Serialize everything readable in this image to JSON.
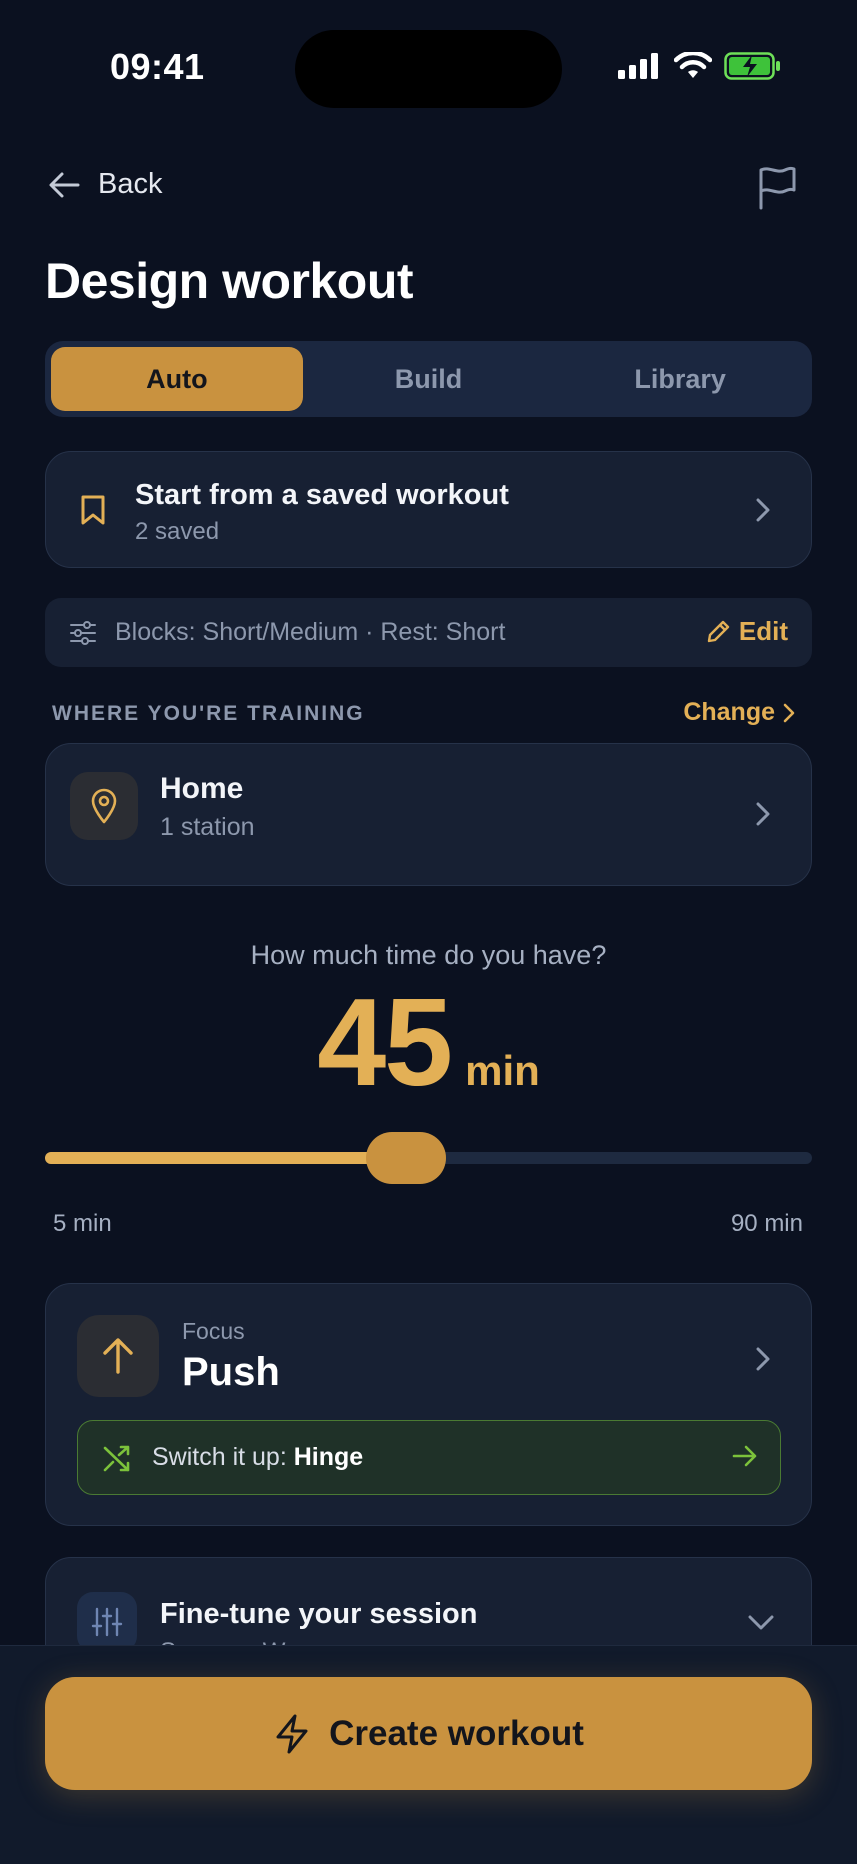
{
  "status_bar": {
    "time": "09:41"
  },
  "nav": {
    "back_label": "Back"
  },
  "page": {
    "title": "Design workout"
  },
  "segmented": {
    "tabs": [
      "Auto",
      "Build",
      "Library"
    ],
    "active": "Auto"
  },
  "saved": {
    "title": "Start from a saved workout",
    "subtitle": "2 saved"
  },
  "summary": {
    "text": "Blocks: Short/Medium · Rest: Short",
    "edit_label": "Edit"
  },
  "training": {
    "section_label": "WHERE YOU'RE TRAINING",
    "change_label": "Change",
    "location": "Home",
    "stations": "1 station"
  },
  "time": {
    "question": "How much time do you have?",
    "value": "45",
    "unit": "min",
    "min_label": "5 min",
    "max_label": "90 min",
    "slider_min": 5,
    "slider_max": 90,
    "slider_value": 45
  },
  "focus": {
    "label": "Focus",
    "value": "Push",
    "switch_prefix": "Switch it up: ",
    "switch_value": "Hinge"
  },
  "fine_tune": {
    "title": "Fine-tune your session",
    "subtitle": "Savage · Warm-up"
  },
  "cta": {
    "label": "Create workout"
  },
  "colors": {
    "background": "#0b1120",
    "card": "#172033",
    "accent": "#c9923f",
    "accent_text": "#e3b056",
    "switch_green": "#7cc23b"
  },
  "icons": {
    "back": "arrow-left-icon",
    "flag": "flag-icon",
    "saved": "bookmark-icon",
    "summary": "sliders-icon",
    "edit": "pencil-icon",
    "location": "map-pin-icon",
    "focus": "arrow-up-icon",
    "switch": "shuffle-icon",
    "fine_tune": "equalizer-icon",
    "cta": "lightning-icon"
  }
}
